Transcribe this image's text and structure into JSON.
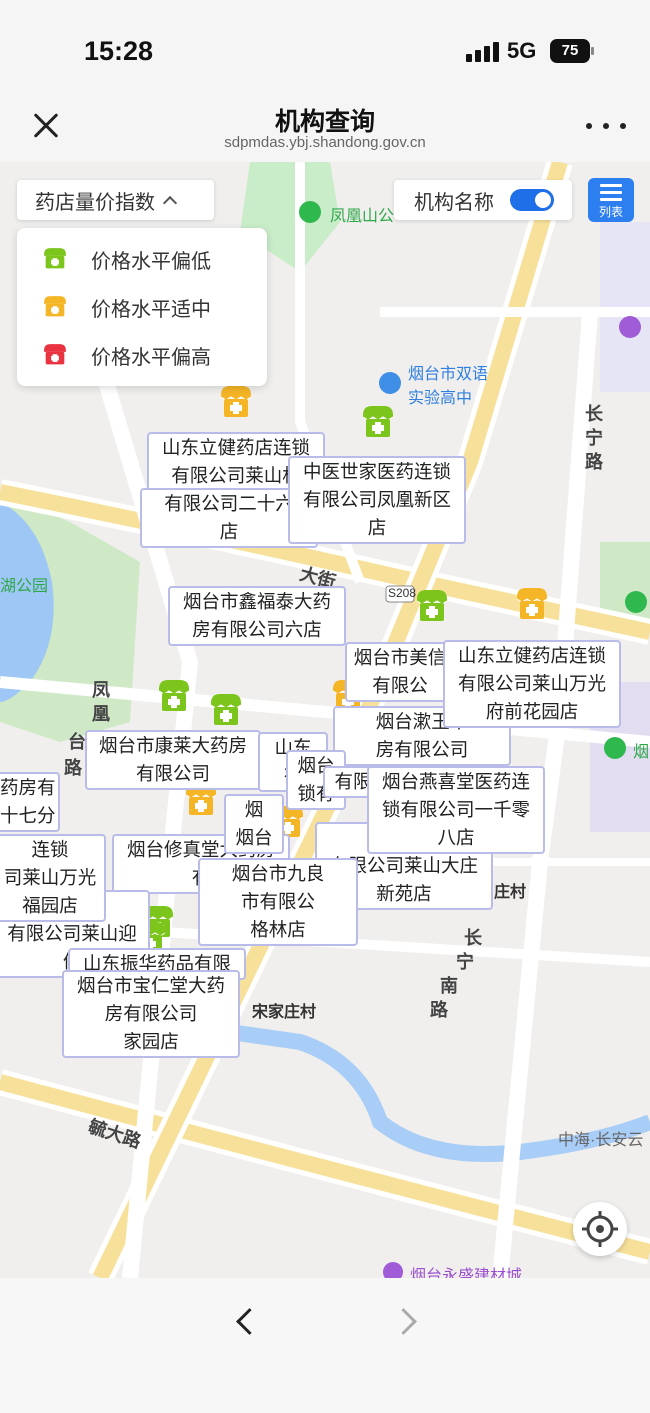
{
  "status_bar": {
    "time": "15:28",
    "network": "5G",
    "battery": "75"
  },
  "nav": {
    "title": "机构查询",
    "url": "sdpmdas.ybj.shandong.gov.cn"
  },
  "controls": {
    "filter_label": "药店量价指数",
    "legend": [
      {
        "label": "价格水平偏低",
        "color": "#7cc51c"
      },
      {
        "label": "价格水平适中",
        "color": "#f4b526"
      },
      {
        "label": "价格水平偏高",
        "color": "#ea3340"
      }
    ],
    "toggle_label": "机构名称",
    "list_label": "列表"
  },
  "map": {
    "road_labels": [
      {
        "text": "长"
      },
      {
        "text": "宁"
      },
      {
        "text": "路"
      },
      {
        "text": "凤"
      },
      {
        "text": "凰"
      },
      {
        "text": "台"
      },
      {
        "text": "路"
      },
      {
        "text": "长"
      },
      {
        "text": "宁"
      },
      {
        "text": "南"
      },
      {
        "text": "路"
      },
      {
        "text": "毓大路"
      },
      {
        "text": "大街"
      }
    ],
    "poi_labels": [
      {
        "text": "凤凰山公"
      },
      {
        "text": "烟台市双语"
      },
      {
        "text": "实验高中"
      },
      {
        "text": "湖公园"
      },
      {
        "text": "S208"
      },
      {
        "text": "庄村"
      },
      {
        "text": "宋家庄村"
      },
      {
        "text": "中海·长安云"
      },
      {
        "text": "烟台永盛建材城"
      },
      {
        "text": "烟"
      }
    ],
    "callouts": [
      {
        "lines": [
          "山东立健药店连锁",
          "有限公司莱山机",
          "路店"
        ]
      },
      {
        "lines": [
          "中医世家医药连锁",
          "有限公司凤凰新区",
          "店"
        ]
      },
      {
        "lines": [
          "有限公司二十六",
          "店"
        ]
      },
      {
        "lines": [
          "烟台市鑫福泰大药",
          "房有限公司六店"
        ]
      },
      {
        "lines": [
          "烟台市美信",
          "有限公"
        ]
      },
      {
        "lines": [
          "山东立健药店连锁",
          "有限公司莱山万光",
          "府前花园店"
        ]
      },
      {
        "lines": [
          "烟台漱玉平",
          "房有限公司",
          "南店"
        ]
      },
      {
        "lines": [
          "烟台市康莱大药房",
          "有限公司"
        ]
      },
      {
        "lines": [
          "山东",
          "有"
        ]
      },
      {
        "lines": [
          "烟台",
          "锁有"
        ]
      },
      {
        "lines": [
          "有限",
          ""
        ]
      },
      {
        "lines": [
          "烟台燕喜堂医药连",
          "锁有限公司一千零",
          "八店"
        ]
      },
      {
        "lines": [
          "药房有",
          "十七分"
        ]
      },
      {
        "lines": [
          "连锁",
          "司莱山万光",
          "福园店"
        ]
      },
      {
        "lines": [
          "烟台修真堂大药房",
          "有"
        ]
      },
      {
        "lines": [
          "山东",
          "有限公司莱山大庄",
          "新苑店"
        ]
      },
      {
        "lines": [
          "烟台市九良",
          "市有限公",
          "格林店"
        ]
      },
      {
        "lines": [
          "店连锁",
          "有限公司莱山迎",
          "佳"
        ]
      },
      {
        "lines": [
          "山东振华药品有限"
        ]
      },
      {
        "lines": [
          "烟台市宝仁堂大药",
          "房有限公司",
          "家园店"
        ]
      },
      {
        "lines": [
          "烟",
          "烟台"
        ]
      }
    ]
  }
}
